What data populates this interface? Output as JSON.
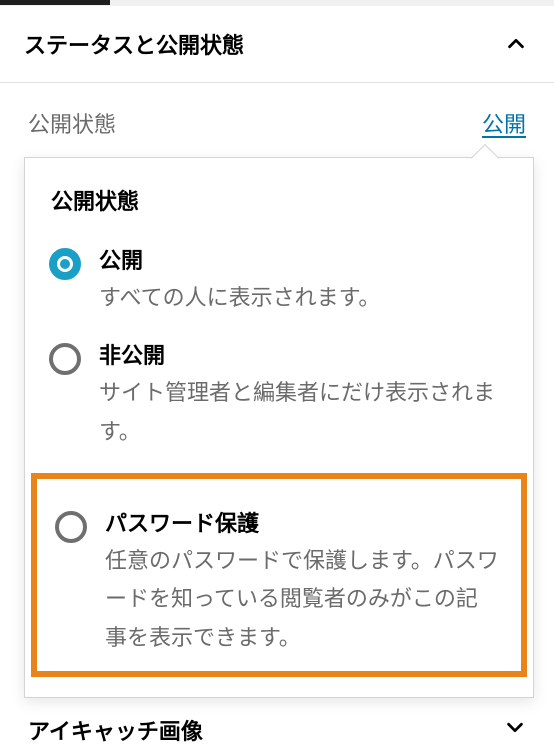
{
  "panel": {
    "title": "ステータスと公開状態"
  },
  "visibility_row": {
    "label": "公開状態",
    "value": "公開"
  },
  "popover": {
    "title": "公開状態",
    "options": {
      "public": {
        "title": "公開",
        "desc": "すべての人に表示されます。"
      },
      "private": {
        "title": "非公開",
        "desc": "サイト管理者と編集者にだけ表示されます。"
      },
      "password": {
        "title": "パスワード保護",
        "desc": "任意のパスワードで保護します。パスワードを知っている閲覧者のみがこの記事を表示できます。"
      }
    }
  },
  "next_panel": {
    "title": "アイキャッチ画像"
  }
}
